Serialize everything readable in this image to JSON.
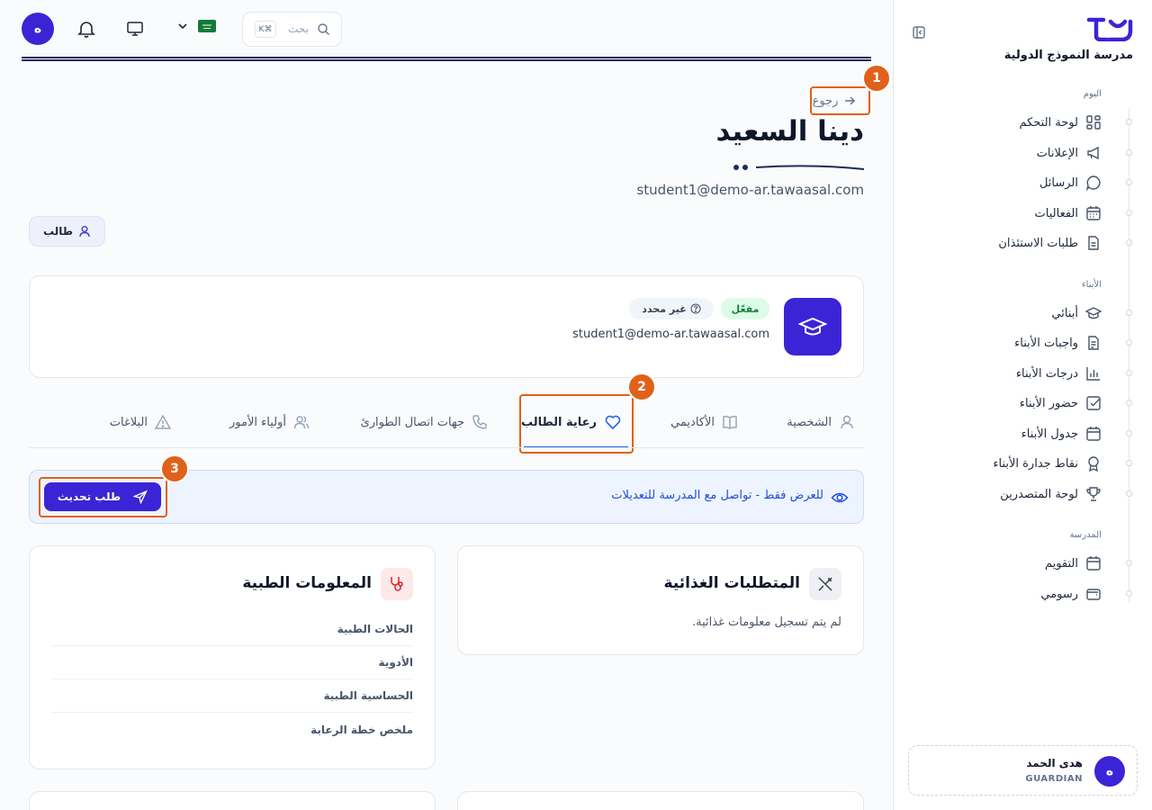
{
  "sidebar": {
    "school_name": "مدرسة النموذج الدولية",
    "sections": [
      {
        "label": "اليوم",
        "items": [
          "لوحة التحكم",
          "الإعلانات",
          "الرسائل",
          "الفعاليات",
          "طلبات الاستئذان"
        ]
      },
      {
        "label": "الأبناء",
        "items": [
          "أبنائي",
          "واجبات الأبناء",
          "درجات الأبناء",
          "حضور الأبناء",
          "جدول الأبناء",
          "نقاط جدارة الأبناء",
          "لوحة المتصدرين"
        ]
      },
      {
        "label": "المدرسة",
        "items": [
          "التقويم",
          "رسومي"
        ]
      }
    ],
    "user": {
      "avatar": "ه",
      "name": "هدى الحمد",
      "role": "GUARDIAN"
    }
  },
  "topbar": {
    "avatar": "ه",
    "search_placeholder": "بحث",
    "shortcut": "K⌘",
    "language_flag": "saudi-flag-icon"
  },
  "header": {
    "back_label": "رجوع",
    "student_name": "دينا السعيد",
    "email": "student1@demo-ar.tawaasal.com",
    "role_chip": "طالب"
  },
  "profile_card": {
    "status_badge": "مفعّل",
    "unknown_badge": "غير محدد",
    "email": "student1@demo-ar.tawaasal.com"
  },
  "tabs": [
    {
      "label": "الشخصية",
      "icon": "user-icon",
      "active": false
    },
    {
      "label": "الأكاديمي",
      "icon": "book-icon",
      "active": false
    },
    {
      "label": "رعاية الطالب",
      "icon": "heart-icon",
      "active": true
    },
    {
      "label": "جهات اتصال الطوارئ",
      "icon": "phone-icon",
      "active": false
    },
    {
      "label": "أولياء الأمور",
      "icon": "users-icon",
      "active": false
    },
    {
      "label": "البلاغات",
      "icon": "alert-icon",
      "active": false
    }
  ],
  "banner": {
    "text": "للعرض فقط - تواصل مع المدرسة للتعديلات",
    "button": "طلب تحديث"
  },
  "dietary": {
    "title": "المتطلبات الغذائية",
    "empty": "لم يتم تسجيل معلومات غذائية."
  },
  "medical": {
    "title": "المعلومات الطبية",
    "rows": [
      "الحالات الطبية",
      "الأدوية",
      "الحساسية الطبية",
      "ملخص خطة الرعاية"
    ]
  },
  "annotations": [
    "1",
    "2",
    "3"
  ],
  "colors": {
    "accent": "#3b24d6",
    "highlight": "#e0611a",
    "tab_active": "#2563eb",
    "success": "#16a34a"
  }
}
